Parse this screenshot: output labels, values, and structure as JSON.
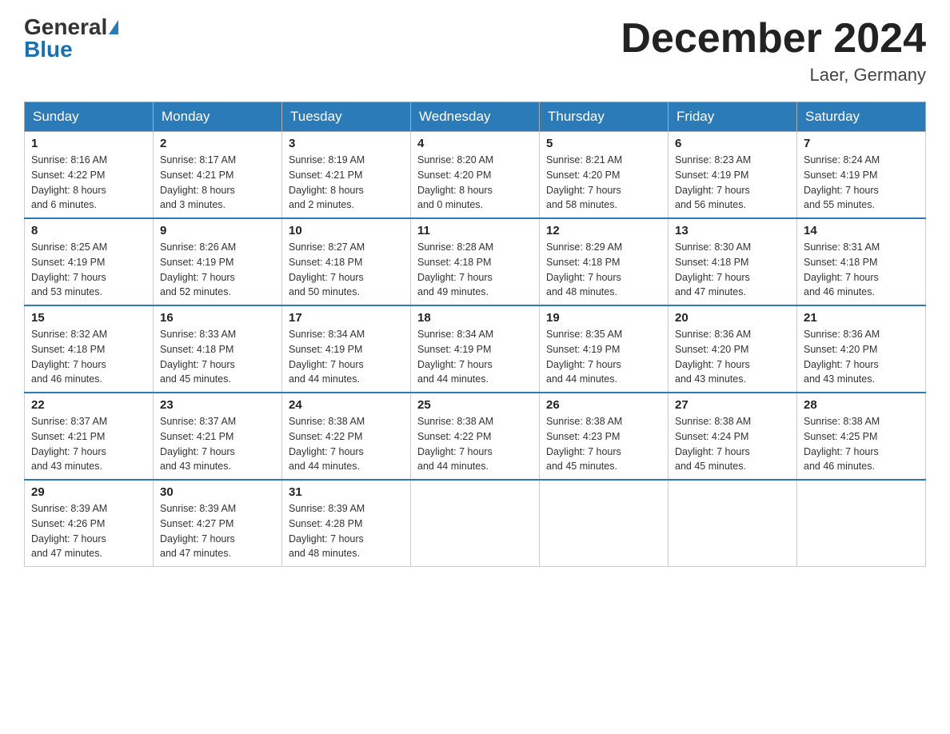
{
  "header": {
    "logo_general": "General",
    "logo_blue": "Blue",
    "month_title": "December 2024",
    "location": "Laer, Germany"
  },
  "weekdays": [
    "Sunday",
    "Monday",
    "Tuesday",
    "Wednesday",
    "Thursday",
    "Friday",
    "Saturday"
  ],
  "weeks": [
    [
      {
        "day": "1",
        "sunrise": "8:16 AM",
        "sunset": "4:22 PM",
        "daylight": "8 hours and 6 minutes."
      },
      {
        "day": "2",
        "sunrise": "8:17 AM",
        "sunset": "4:21 PM",
        "daylight": "8 hours and 3 minutes."
      },
      {
        "day": "3",
        "sunrise": "8:19 AM",
        "sunset": "4:21 PM",
        "daylight": "8 hours and 2 minutes."
      },
      {
        "day": "4",
        "sunrise": "8:20 AM",
        "sunset": "4:20 PM",
        "daylight": "8 hours and 0 minutes."
      },
      {
        "day": "5",
        "sunrise": "8:21 AM",
        "sunset": "4:20 PM",
        "daylight": "7 hours and 58 minutes."
      },
      {
        "day": "6",
        "sunrise": "8:23 AM",
        "sunset": "4:19 PM",
        "daylight": "7 hours and 56 minutes."
      },
      {
        "day": "7",
        "sunrise": "8:24 AM",
        "sunset": "4:19 PM",
        "daylight": "7 hours and 55 minutes."
      }
    ],
    [
      {
        "day": "8",
        "sunrise": "8:25 AM",
        "sunset": "4:19 PM",
        "daylight": "7 hours and 53 minutes."
      },
      {
        "day": "9",
        "sunrise": "8:26 AM",
        "sunset": "4:19 PM",
        "daylight": "7 hours and 52 minutes."
      },
      {
        "day": "10",
        "sunrise": "8:27 AM",
        "sunset": "4:18 PM",
        "daylight": "7 hours and 50 minutes."
      },
      {
        "day": "11",
        "sunrise": "8:28 AM",
        "sunset": "4:18 PM",
        "daylight": "7 hours and 49 minutes."
      },
      {
        "day": "12",
        "sunrise": "8:29 AM",
        "sunset": "4:18 PM",
        "daylight": "7 hours and 48 minutes."
      },
      {
        "day": "13",
        "sunrise": "8:30 AM",
        "sunset": "4:18 PM",
        "daylight": "7 hours and 47 minutes."
      },
      {
        "day": "14",
        "sunrise": "8:31 AM",
        "sunset": "4:18 PM",
        "daylight": "7 hours and 46 minutes."
      }
    ],
    [
      {
        "day": "15",
        "sunrise": "8:32 AM",
        "sunset": "4:18 PM",
        "daylight": "7 hours and 46 minutes."
      },
      {
        "day": "16",
        "sunrise": "8:33 AM",
        "sunset": "4:18 PM",
        "daylight": "7 hours and 45 minutes."
      },
      {
        "day": "17",
        "sunrise": "8:34 AM",
        "sunset": "4:19 PM",
        "daylight": "7 hours and 44 minutes."
      },
      {
        "day": "18",
        "sunrise": "8:34 AM",
        "sunset": "4:19 PM",
        "daylight": "7 hours and 44 minutes."
      },
      {
        "day": "19",
        "sunrise": "8:35 AM",
        "sunset": "4:19 PM",
        "daylight": "7 hours and 44 minutes."
      },
      {
        "day": "20",
        "sunrise": "8:36 AM",
        "sunset": "4:20 PM",
        "daylight": "7 hours and 43 minutes."
      },
      {
        "day": "21",
        "sunrise": "8:36 AM",
        "sunset": "4:20 PM",
        "daylight": "7 hours and 43 minutes."
      }
    ],
    [
      {
        "day": "22",
        "sunrise": "8:37 AM",
        "sunset": "4:21 PM",
        "daylight": "7 hours and 43 minutes."
      },
      {
        "day": "23",
        "sunrise": "8:37 AM",
        "sunset": "4:21 PM",
        "daylight": "7 hours and 43 minutes."
      },
      {
        "day": "24",
        "sunrise": "8:38 AM",
        "sunset": "4:22 PM",
        "daylight": "7 hours and 44 minutes."
      },
      {
        "day": "25",
        "sunrise": "8:38 AM",
        "sunset": "4:22 PM",
        "daylight": "7 hours and 44 minutes."
      },
      {
        "day": "26",
        "sunrise": "8:38 AM",
        "sunset": "4:23 PM",
        "daylight": "7 hours and 45 minutes."
      },
      {
        "day": "27",
        "sunrise": "8:38 AM",
        "sunset": "4:24 PM",
        "daylight": "7 hours and 45 minutes."
      },
      {
        "day": "28",
        "sunrise": "8:38 AM",
        "sunset": "4:25 PM",
        "daylight": "7 hours and 46 minutes."
      }
    ],
    [
      {
        "day": "29",
        "sunrise": "8:39 AM",
        "sunset": "4:26 PM",
        "daylight": "7 hours and 47 minutes."
      },
      {
        "day": "30",
        "sunrise": "8:39 AM",
        "sunset": "4:27 PM",
        "daylight": "7 hours and 47 minutes."
      },
      {
        "day": "31",
        "sunrise": "8:39 AM",
        "sunset": "4:28 PM",
        "daylight": "7 hours and 48 minutes."
      },
      null,
      null,
      null,
      null
    ]
  ],
  "labels": {
    "sunrise": "Sunrise:",
    "sunset": "Sunset:",
    "daylight": "Daylight:"
  }
}
